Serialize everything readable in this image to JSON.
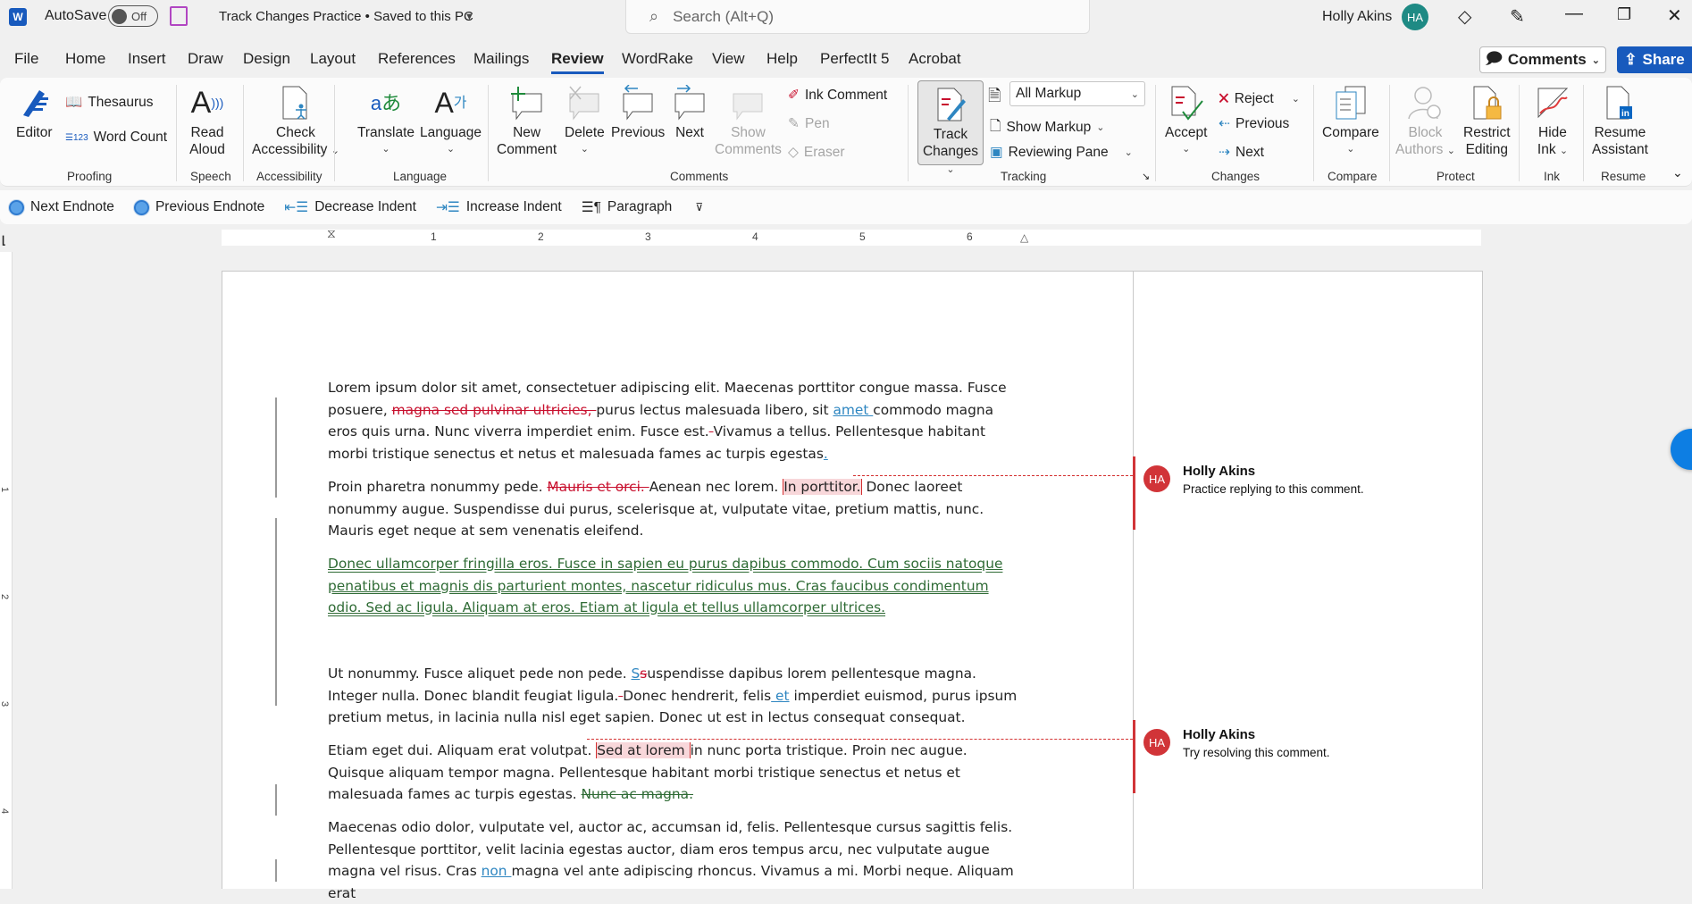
{
  "titlebar": {
    "autosave_label": "AutoSave",
    "autosave_state": "Off",
    "doc_title": "Track Changes Practice • Saved to this PC",
    "search_placeholder": "Search (Alt+Q)",
    "user_name": "Holly Akins",
    "user_initials": "HA"
  },
  "tabs": [
    "File",
    "Home",
    "Insert",
    "Draw",
    "Design",
    "Layout",
    "References",
    "Mailings",
    "Review",
    "WordRake",
    "View",
    "Help",
    "PerfectIt 5",
    "Acrobat"
  ],
  "active_tab": "Review",
  "header_buttons": {
    "comments": "Comments",
    "share": "Share"
  },
  "ribbon": {
    "proofing": {
      "label": "Proofing",
      "editor": "Editor",
      "thesaurus": "Thesaurus",
      "word_count": "Word Count"
    },
    "speech": {
      "label": "Speech",
      "read_aloud_1": "Read",
      "read_aloud_2": "Aloud"
    },
    "accessibility": {
      "label": "Accessibility",
      "check_1": "Check",
      "check_2": "Accessibility"
    },
    "language": {
      "label": "Language",
      "translate": "Translate",
      "language": "Language"
    },
    "comments": {
      "label": "Comments",
      "new_1": "New",
      "new_2": "Comment",
      "delete": "Delete",
      "previous": "Previous",
      "next": "Next",
      "show_1": "Show",
      "show_2": "Comments",
      "ink_comment": "Ink Comment",
      "pen": "Pen",
      "eraser": "Eraser"
    },
    "tracking": {
      "label": "Tracking",
      "track_1": "Track",
      "track_2": "Changes",
      "markup_select": "All Markup",
      "show_markup": "Show Markup",
      "reviewing_pane": "Reviewing Pane"
    },
    "changes": {
      "label": "Changes",
      "accept": "Accept",
      "reject": "Reject",
      "previous": "Previous",
      "next": "Next"
    },
    "compare": {
      "label": "Compare",
      "compare": "Compare"
    },
    "protect": {
      "label": "Protect",
      "block_1": "Block",
      "block_2": "Authors",
      "restrict_1": "Restrict",
      "restrict_2": "Editing"
    },
    "ink": {
      "label": "Ink",
      "hide_1": "Hide",
      "hide_2": "Ink"
    },
    "resume": {
      "label": "Resume",
      "resume_1": "Resume",
      "resume_2": "Assistant"
    }
  },
  "qat": {
    "next_endnote": "Next Endnote",
    "previous_endnote": "Previous Endnote",
    "decrease_indent": "Decrease Indent",
    "increase_indent": "Increase Indent",
    "paragraph": "Paragraph"
  },
  "ruler": {
    "h_marks": [
      "1",
      "2",
      "3",
      "4",
      "5",
      "6"
    ],
    "v_marks": [
      "1",
      "2",
      "3",
      "4"
    ]
  },
  "document": {
    "p1": {
      "a": "Lorem ipsum dolor sit amet, consectetuer adipiscing elit. Maecenas porttitor congue massa. Fusce posuere, ",
      "del1": "magna sed pulvinar ultricies, ",
      "b": "purus lectus malesuada libero, sit ",
      "ins1": "amet ",
      "c": "commodo magna eros quis urna. Nunc viverra imperdiet enim. Fusce est.",
      "del2": " ",
      "d": "Vivamus a tellus. Pellentesque habitant morbi tristique senectus et netus et malesuada fames ac turpis egestas",
      "ins2": "."
    },
    "p2": {
      "a": "Proin pharetra nonummy pede. ",
      "del1": "Mauris et orci. ",
      "b": "Aenean nec lorem. ",
      "hl": "In porttitor.",
      "c": " Donec laoreet nonummy augue. Suspendisse dui purus, scelerisque at, vulputate vitae, pretium mattis, nunc. Mauris eget neque at sem venenatis eleifend."
    },
    "p3": "Donec ullamcorper fringilla eros. Fusce in sapien eu purus dapibus commodo. Cum sociis natoque penatibus et magnis dis parturient montes, nascetur ridiculus mus. Cras faucibus condimentum odio. Sed ac ligula. Aliquam at eros. Etiam at ligula et tellus ullamcorper ultrices.",
    "p4": {
      "a": "Ut nonummy. Fusce aliquet pede non pede. ",
      "ins1": "S",
      "del1": "s",
      "b": "uspendisse dapibus lorem pellentesque magna. Integer nulla. Donec blandit feugiat ligula.",
      "del2": " ",
      "c": "Donec hendrerit, felis",
      "ins2": " et",
      "d": " imperdiet euismod, purus ipsum pretium metus, in lacinia nulla nisl eget sapien. Donec ut est in lectus consequat consequat."
    },
    "p5": {
      "a": "Etiam eget dui. Aliquam erat volutpat. ",
      "hl": "Sed at lorem ",
      "b": "in nunc porta tristique. Proin nec augue. Quisque aliquam tempor magna. Pellentesque habitant morbi tristique senectus et netus et malesuada fames ac turpis egestas. ",
      "del1": "Nunc ac magna."
    },
    "p6": {
      "a": "Maecenas odio dolor, vulputate vel, auctor ac, accumsan id, felis. Pellentesque cursus sagittis felis. Pellentesque porttitor, velit lacinia egestas auctor, diam eros tempus arcu, nec vulputate augue magna vel risus. Cras ",
      "ins1": "non ",
      "b": "magna vel ante adipiscing rhoncus. Vivamus a mi. Morbi neque. Aliquam erat"
    }
  },
  "comments": [
    {
      "initials": "HA",
      "author": "Holly Akins",
      "text": "Practice replying to this comment."
    },
    {
      "initials": "HA",
      "author": "Holly Akins",
      "text": "Try resolving this comment."
    }
  ],
  "colors": {
    "accent": "#185abd",
    "deletion": "#c8102e",
    "insertion": "#2e86c1",
    "moved": "#2f6b35",
    "comment": "#d13438",
    "avatar": "#1e8a84"
  }
}
